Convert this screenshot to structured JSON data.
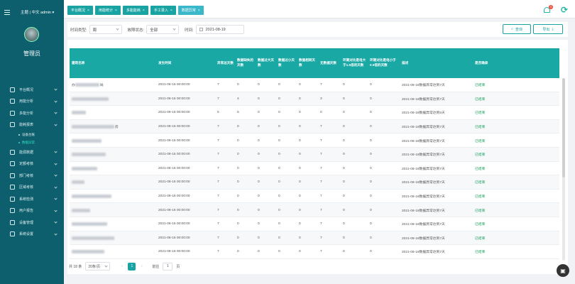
{
  "header": {
    "user_text": "主题 | 中文  admin ▾",
    "role": "管理员",
    "notification_count": "3"
  },
  "tabs": [
    {
      "label": "平台概况",
      "active": false
    },
    {
      "label": "用能统计",
      "active": false
    },
    {
      "label": "多能能耗",
      "active": false
    },
    {
      "label": "手工录入",
      "active": false
    },
    {
      "label": "数据异常",
      "active": true
    }
  ],
  "sidebar": {
    "items": [
      {
        "label": "平台概况"
      },
      {
        "label": "用能分析"
      },
      {
        "label": "多能分析"
      },
      {
        "label": "能耗报表"
      },
      {
        "label": "设备台账",
        "sub": true
      },
      {
        "label": "数据异常",
        "sub": true,
        "active": true
      },
      {
        "label": "能源数据"
      },
      {
        "label": "定额考核"
      },
      {
        "label": "部门考核"
      },
      {
        "label": "区域考核"
      },
      {
        "label": "系统检测"
      },
      {
        "label": "用户报告"
      },
      {
        "label": "设备管理"
      },
      {
        "label": "系统设置"
      }
    ]
  },
  "filters": {
    "time_type_label": "时间类型:",
    "time_type_value": "周",
    "status_label": "故障状态:",
    "status_value": "全部",
    "time_label": "时间:",
    "time_value": "2021-08-19",
    "search_label": "查询",
    "export_label": "导出"
  },
  "table": {
    "columns": [
      "建筑名称",
      "发生时间",
      "异常总天数",
      "数据缺失的天数",
      "数据过大天数",
      "数据过小天数",
      "数据相同天数",
      "无数据天数",
      "环期对比是电大于1.5倍的天数",
      "环期对比是电小于0.5倍的天数",
      "描述",
      "是否确录"
    ],
    "rows": [
      {
        "name": "办  ",
        "blur": 34,
        "suffix": "局",
        "time": "2021-08-16 00:00:00",
        "vals": [
          "7",
          "0",
          "0",
          "0",
          "0",
          "7",
          "0",
          "0"
        ],
        "desc": "2021-08-16数据异常达到7天",
        "status": "已结束"
      },
      {
        "name": "",
        "blur": 52,
        "suffix": "",
        "time": "2021-08-16 00:00:00",
        "vals": [
          "7",
          "4",
          "0",
          "0",
          "0",
          "3",
          "0",
          "0"
        ],
        "desc": "2021-08-16数据异常达到7天",
        "status": "已结束"
      },
      {
        "name": "",
        "blur": 20,
        "suffix": "",
        "time": "2021-08-16 00:00:00",
        "vals": [
          "5",
          "5",
          "0",
          "0",
          "0",
          "0",
          "0",
          "0"
        ],
        "desc": "2021-08-16数据异常达到5天",
        "status": "已结束"
      },
      {
        "name": "",
        "blur": 60,
        "suffix": "房",
        "time": "2021-08-16 00:00:00",
        "vals": [
          "7",
          "0",
          "0",
          "0",
          "0",
          "7",
          "0",
          "0"
        ],
        "desc": "2021-08-16数据异常达到7天",
        "status": "已结束"
      },
      {
        "name": "",
        "blur": 42,
        "suffix": "",
        "time": "2021-08-16 00:00:00",
        "vals": [
          "7",
          "0",
          "0",
          "0",
          "0",
          "7",
          "0",
          "0"
        ],
        "desc": "2021-08-16数据异常达到7天",
        "status": "已结束"
      },
      {
        "name": "",
        "blur": 48,
        "suffix": "",
        "time": "2021-08-16 00:00:00",
        "vals": [
          "7",
          "0",
          "0",
          "0",
          "0",
          "7",
          "0",
          "0"
        ],
        "desc": "2021-08-16数据异常达到7天",
        "status": "已结束"
      },
      {
        "name": "",
        "blur": 36,
        "suffix": "",
        "time": "2021-08-16 00:00:00",
        "vals": [
          "7",
          "0",
          "0",
          "0",
          "0",
          "7",
          "0",
          "0"
        ],
        "desc": "2021-08-16数据异常达到7天",
        "status": "已结束"
      },
      {
        "name": "",
        "blur": 18,
        "suffix": "",
        "time": "2021-08-16 00:00:00",
        "vals": [
          "7",
          "0",
          "0",
          "0",
          "0",
          "7",
          "0",
          "0"
        ],
        "desc": "2021-08-16数据异常达到7天",
        "status": "已结束"
      },
      {
        "name": "",
        "blur": 56,
        "suffix": "",
        "time": "2021-08-16 00:00:00",
        "vals": [
          "7",
          "0",
          "0",
          "0",
          "0",
          "7",
          "0",
          "0"
        ],
        "desc": "2021-08-16数据异常达到7天",
        "status": "已结束"
      },
      {
        "name": "",
        "blur": 26,
        "suffix": "",
        "time": "2021-08-16 00:00:00",
        "vals": [
          "7",
          "0",
          "0",
          "0",
          "0",
          "7",
          "0",
          "0"
        ],
        "desc": "2021-08-16数据异常达到7天",
        "status": "已结束"
      },
      {
        "name": "",
        "blur": 50,
        "suffix": "",
        "time": "2021-08-16 00:00:00",
        "vals": [
          "7",
          "0",
          "0",
          "0",
          "0",
          "7",
          "0",
          "0"
        ],
        "desc": "2021-08-16数据异常达到7天",
        "status": "已结束"
      },
      {
        "name": "",
        "blur": 60,
        "suffix": "",
        "time": "2021-08-16 00:00:00",
        "vals": [
          "7",
          "0",
          "0",
          "0",
          "0",
          "7",
          "0",
          "0"
        ],
        "desc": "2021-08-16数据异常达到7天",
        "status": "已结束"
      },
      {
        "name": "",
        "blur": 46,
        "suffix": "",
        "time": "2021-08-16 00:00:00",
        "vals": [
          "7",
          "0",
          "0",
          "0",
          "0",
          "7",
          "0",
          "0"
        ],
        "desc": "2021-08-16数据异常达到7天",
        "status": "已结束"
      }
    ]
  },
  "pagination": {
    "total": "共 18 条",
    "page_size": "20条/页",
    "current_page": "1",
    "goto_label": "前往",
    "goto_value": "1",
    "page_suffix": "页"
  }
}
